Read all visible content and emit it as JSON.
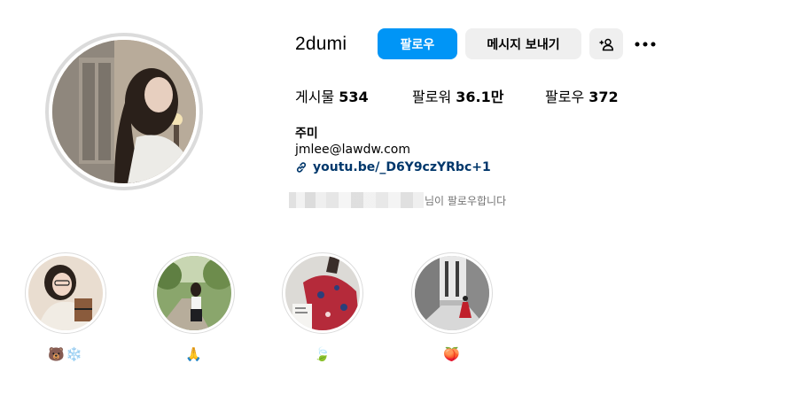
{
  "profile": {
    "username": "2dumi",
    "full_name": "주미",
    "email": "jmlee@lawdw.com",
    "link": "youtu.be/_D6Y9czYRbc+1",
    "followed_by_suffix": "님이 팔로우합니다"
  },
  "actions": {
    "follow_label": "팔로우",
    "message_label": "메시지 보내기",
    "add_user_icon": "person-add-icon",
    "more_icon": "more-horizontal-icon"
  },
  "stats": [
    {
      "label": "게시물",
      "value": "534"
    },
    {
      "label": "팔로워",
      "value": "36.1만"
    },
    {
      "label": "팔로우",
      "value": "372"
    }
  ],
  "highlights": [
    {
      "label": "🐻❄️"
    },
    {
      "label": "🙏"
    },
    {
      "label": "🍃"
    },
    {
      "label": "🍑"
    }
  ],
  "colors": {
    "accent": "#0095f6",
    "link": "#00376b",
    "secondary_text": "#737373",
    "button_bg": "#efefef"
  }
}
